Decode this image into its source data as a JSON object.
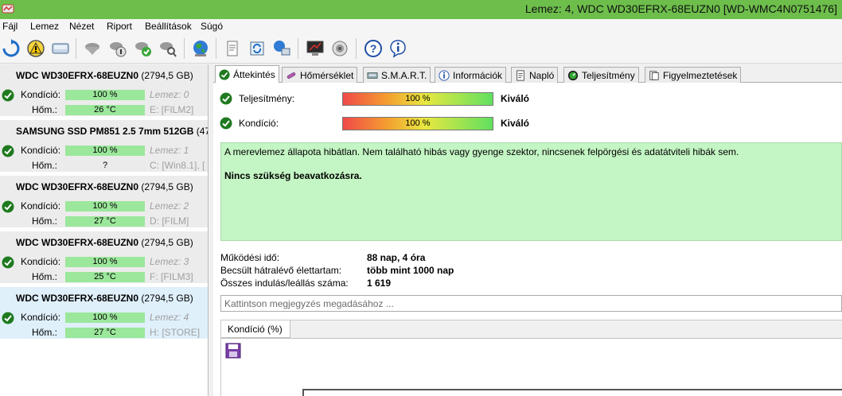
{
  "window": {
    "title": "Lemez: 4, WDC WD30EFRX-68EUZN0 [WD-WMC4N0751476]",
    "title_bar_color": "#6dbe4b"
  },
  "menu": [
    {
      "label": "Fájl"
    },
    {
      "label": "Lemez"
    },
    {
      "label": "Nézet"
    },
    {
      "label": "Riport"
    },
    {
      "label": "Beállítások"
    },
    {
      "label": "Súgó"
    }
  ],
  "toolbar": {
    "icons": [
      "refresh-icon",
      "warning-icon",
      "disk-icon",
      "disk-tool-icon",
      "disk-info-icon",
      "disk-check-icon",
      "disk-scan-icon",
      "globe-icon",
      "report-icon",
      "sync-icon",
      "network-icon",
      "monitor-icon",
      "speaker-icon",
      "help-icon",
      "info-icon"
    ]
  },
  "disks": [
    {
      "name": "WDC WD30EFRX-68EUZN0",
      "size": "(2794,5 GB)",
      "condition_label": "Kondíció:",
      "condition_value": "100 %",
      "temp_label": "Hőm.:",
      "temp_value": "26 °C",
      "disk_meta": "Lemez: 0",
      "drive_meta": "E: [FILM2]",
      "selected": false
    },
    {
      "name": "SAMSUNG SSD PM851 2.5 7mm 512GB",
      "size": "(47",
      "condition_label": "Kondíció:",
      "condition_value": "100 %",
      "temp_label": "Hőm.:",
      "temp_value": "?",
      "disk_meta": "Lemez: 1",
      "drive_meta": "C: [Win8.1],  [",
      "selected": false
    },
    {
      "name": "WDC WD30EFRX-68EUZN0",
      "size": "(2794,5 GB)",
      "condition_label": "Kondíció:",
      "condition_value": "100 %",
      "temp_label": "Hőm.:",
      "temp_value": "27 °C",
      "disk_meta": "Lemez: 2",
      "drive_meta": "D: [FILM]",
      "selected": false
    },
    {
      "name": "WDC WD30EFRX-68EUZN0",
      "size": "(2794,5 GB)",
      "condition_label": "Kondíció:",
      "condition_value": "100 %",
      "temp_label": "Hőm.:",
      "temp_value": "25 °C",
      "disk_meta": "Lemez: 3",
      "drive_meta": "F: [FILM3]",
      "selected": false
    },
    {
      "name": "WDC WD30EFRX-68EUZN0",
      "size": "(2794,5 GB)",
      "condition_label": "Kondíció:",
      "condition_value": "100 %",
      "temp_label": "Hőm.:",
      "temp_value": "27 °C",
      "disk_meta": "Lemez: 4",
      "drive_meta": "H: [STORE]",
      "selected": true
    }
  ],
  "tabs": [
    {
      "label": "Áttekintés",
      "icon": "check-icon",
      "active": true
    },
    {
      "label": "Hőmérséklet",
      "icon": "thermometer-icon",
      "active": false
    },
    {
      "label": "S.M.A.R.T.",
      "icon": "smart-icon",
      "active": false
    },
    {
      "label": "Információk",
      "icon": "info-icon",
      "active": false
    },
    {
      "label": "Napló",
      "icon": "log-icon",
      "active": false
    },
    {
      "label": "Teljesítmény",
      "icon": "performance-icon",
      "active": false
    },
    {
      "label": "Figyelmeztetések",
      "icon": "alerts-icon",
      "active": false
    }
  ],
  "overview": {
    "performance_label": "Teljesítmény:",
    "performance_value": "100 %",
    "performance_percent": 100,
    "performance_grade": "Kiváló",
    "condition_label": "Kondíció:",
    "condition_value": "100 %",
    "condition_percent": 100,
    "condition_grade": "Kiváló",
    "message": "A merevlemez állapota hibátlan. Nem található hibás vagy gyenge szektor, nincsenek felpörgési és adatátviteli hibák sem.",
    "advice": "Nincs szükség beavatkozásra.",
    "uptime_label": "Működési idő:",
    "uptime_value": "88 nap, 4 óra",
    "remaining_label": "Becsült hátralévő élettartam:",
    "remaining_value": "több mint 1000 nap",
    "startstop_label": "Összes indulás/leállás száma:",
    "startstop_value": "1 619",
    "note_placeholder": "Kattintson megjegyzés megadásához ...",
    "subtab_label": "Kondíció  (%)"
  }
}
